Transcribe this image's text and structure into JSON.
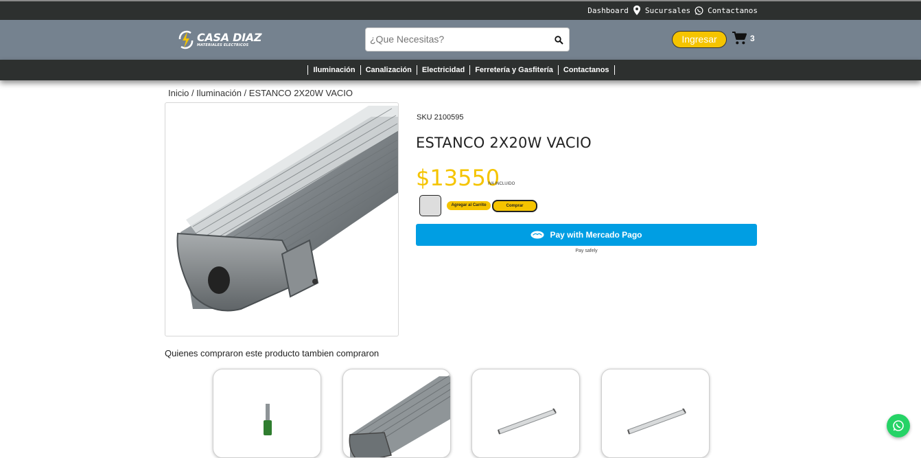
{
  "topbar": {
    "dashboard": "Dashboard",
    "sucursales": "Sucursales",
    "contactanos": "Contactanos"
  },
  "header": {
    "logo_name": "CASA DIAZ",
    "logo_sub": "MATERIALES ELECTRICOS",
    "search_placeholder": "¿Que Necesitas?",
    "login_label": "Ingresar",
    "cart_count": "3"
  },
  "nav": {
    "items": [
      {
        "label": "Iluminación"
      },
      {
        "label": "Canalización"
      },
      {
        "label": "Electricidad"
      },
      {
        "label": "Ferretería y Gasfitería"
      },
      {
        "label": "Contactanos"
      }
    ]
  },
  "breadcrumb": {
    "text": "Inicio / Iluminación / ESTANCO 2X20W VACIO"
  },
  "product": {
    "sku": "SKU 2100595",
    "title": "ESTANCO 2X20W VACIO",
    "price": "$13550",
    "iva": "IVA INCLUIDO",
    "add_to_cart": "Agregar al Carrito",
    "buy": "Comprar",
    "mp_label": "Pay with Mercado Pago",
    "pay_safely": "Pay safely"
  },
  "related": {
    "title": "Quienes compraron este producto tambien compraron"
  },
  "colors": {
    "accent": "#f5c400",
    "dark": "#2d302f",
    "header": "#75828f",
    "mercadopago": "#009ee3",
    "whatsapp": "#25d366"
  },
  "icons": [
    "location-pin-icon",
    "whatsapp-icon",
    "search-icon",
    "cart-icon",
    "lightning-logo-icon",
    "mercadopago-hand-icon"
  ]
}
